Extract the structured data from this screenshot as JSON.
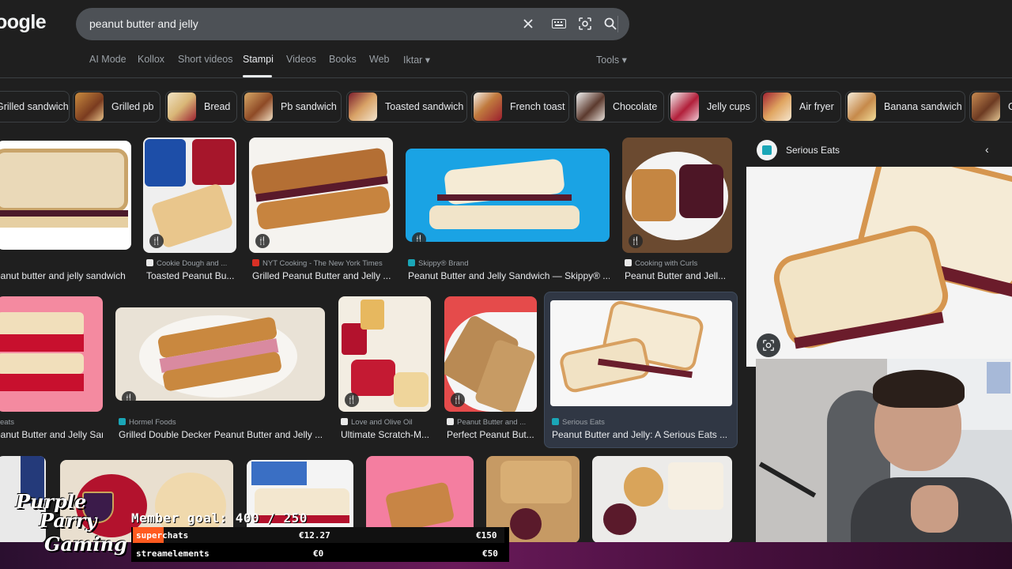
{
  "logo": "oogle",
  "search": {
    "query": "peanut butter and jelly"
  },
  "tabs": [
    "AI Mode",
    "Kollox",
    "Short videos",
    "Stampi",
    "Videos",
    "Books",
    "Web",
    "Iktar"
  ],
  "tools_label": "Tools",
  "chips": [
    "Grilled sandwich",
    "Grilled pb",
    "Bread",
    "Pb sandwich",
    "Toasted sandwich",
    "French toast",
    "Chocolate",
    "Jelly cups",
    "Air fryer",
    "Banana sandwich",
    "G"
  ],
  "results_row1": [
    {
      "source": "",
      "title": "Peanut butter and jelly sandwich - Wiki..."
    },
    {
      "source": "Cookie Dough and ...",
      "title": "Toasted Peanut Bu..."
    },
    {
      "source": "NYT Cooking - The New York Times",
      "title": "Grilled Peanut Butter and Jelly ..."
    },
    {
      "source": "Skippy® Brand",
      "title": "Peanut Butter and Jelly Sandwich — Skippy® ..."
    },
    {
      "source": "Cooking with Curls",
      "title": "Peanut Butter and Jell..."
    }
  ],
  "results_row2": [
    {
      "source": "eats",
      "title": "Peanut Butter and Jelly Sandwic..."
    },
    {
      "source": "Hormel Foods",
      "title": "Grilled Double Decker Peanut Butter and Jelly ..."
    },
    {
      "source": "Love and Olive Oil",
      "title": "Ultimate Scratch-M..."
    },
    {
      "source": "Peanut Butter and ...",
      "title": "Perfect Peanut But..."
    },
    {
      "source": "Serious Eats",
      "title": "Peanut Butter and Jelly: A Serious Eats ..."
    }
  ],
  "panel": {
    "source_name": "Serious Eats"
  },
  "overlay": {
    "goal_text": "Member goal: 400 / 250",
    "rows": [
      {
        "label": "superchats",
        "current": "€12.27",
        "target": "€150"
      },
      {
        "label": "streamelements",
        "current": "€0",
        "target": "€50"
      }
    ],
    "brand_lines": [
      "Purple",
      "Parry",
      "Gaming"
    ]
  },
  "colors": {
    "background": "#1f1f1f",
    "searchbox": "#4d5156",
    "accent_orange": "#ff5a1f"
  }
}
